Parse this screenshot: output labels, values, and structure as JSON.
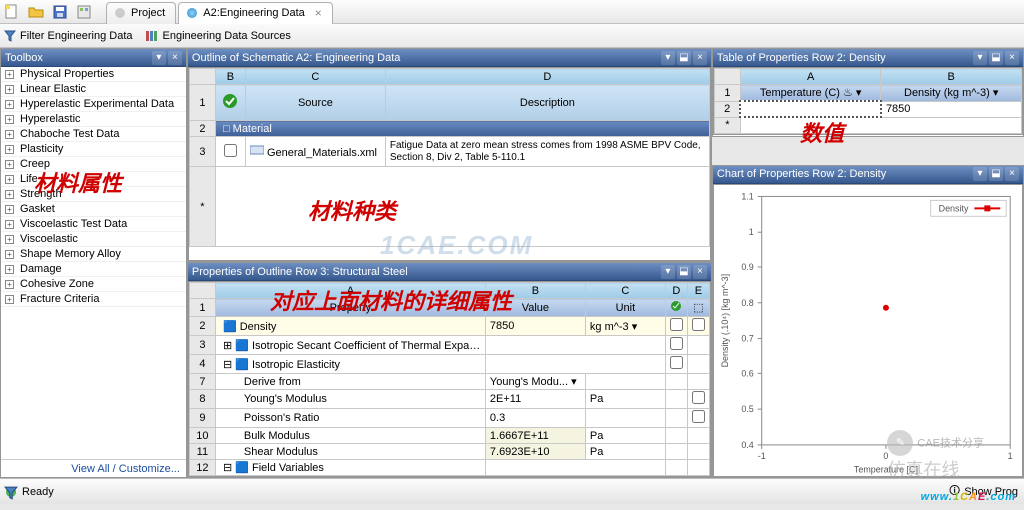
{
  "tabs": {
    "project": "Project",
    "active": "A2:Engineering Data",
    "close": "×"
  },
  "filterbar": {
    "filter": "Filter Engineering Data",
    "sources": "Engineering Data Sources"
  },
  "toolbox": {
    "title": "Toolbox",
    "items": [
      "Physical Properties",
      "Linear Elastic",
      "Hyperelastic Experimental Data",
      "Hyperelastic",
      "Chaboche Test Data",
      "Plasticity",
      "Creep",
      "Life",
      "Strength",
      "Gasket",
      "Viscoelastic Test Data",
      "Viscoelastic",
      "Shape Memory Alloy",
      "Damage",
      "Cohesive Zone",
      "Fracture Criteria"
    ],
    "footer": "View All / Customize..."
  },
  "outline": {
    "title": "Outline of Schematic A2: Engineering Data",
    "colB": "B",
    "colC": "C",
    "colD": "D",
    "r2_rh": "1",
    "r2_C": "Source",
    "r2_D": "Description",
    "mat_hdr_rh": "2",
    "mat_hdr": "Material",
    "r3_rh": "3",
    "r3_file": "General_Materials.xml",
    "r3_desc": "Fatigue Data at zero mean stress comes from 1998 ASME BPV Code, Section 8, Div 2, Table 5-110.1",
    "rstar": "*"
  },
  "props": {
    "title": "Properties of Outline Row 3: Structural Steel",
    "colA": "A",
    "colB": "B",
    "colC": "C",
    "colD": "D",
    "colE": "E",
    "h_prop": "Property",
    "h_val": "Value",
    "h_unit": "Unit",
    "rows": [
      {
        "rh": "2",
        "prop": "Density",
        "val": "7850",
        "unit": "kg m^-3"
      },
      {
        "rh": "3",
        "prop": "Isotropic Secant Coefficient of Thermal Expansion",
        "val": "",
        "unit": ""
      },
      {
        "rh": "4",
        "prop": "Isotropic Elasticity",
        "val": "",
        "unit": ""
      },
      {
        "rh": "7",
        "prop": "Derive from",
        "val": "Young's Modu...",
        "unit": ""
      },
      {
        "rh": "8",
        "prop": "Young's Modulus",
        "val": "2E+11",
        "unit": "Pa"
      },
      {
        "rh": "9",
        "prop": "Poisson's Ratio",
        "val": "0.3",
        "unit": ""
      },
      {
        "rh": "10",
        "prop": "Bulk Modulus",
        "val": "1.6667E+11",
        "unit": "Pa"
      },
      {
        "rh": "11",
        "prop": "Shear Modulus",
        "val": "7.6923E+10",
        "unit": "Pa"
      },
      {
        "rh": "12",
        "prop": "Field Variables",
        "val": "",
        "unit": ""
      }
    ]
  },
  "tprops": {
    "title": "Table of Properties Row 2: Density",
    "colA": "A",
    "colB": "B",
    "h1_rh": "1",
    "h1_A": "Temperature (C)",
    "h1_B": "Density (kg m^-3)",
    "r2_rh": "2",
    "r2_B": "7850",
    "rstar": "*"
  },
  "chart": {
    "title": "Chart of Properties Row 2: Density",
    "legend": "Density",
    "xlabel": "Temperature [C]",
    "ylabel": "Density (.10⁴) [kg m^-3]"
  },
  "chart_data": {
    "type": "scatter",
    "title": "Chart of Properties Row 2: Density",
    "xlabel": "Temperature [C]",
    "ylabel": "Density (.10^4) [kg m^-3]",
    "x": [
      0
    ],
    "y": [
      0.785
    ],
    "xlim": [
      -1,
      1
    ],
    "ylim": [
      0.4,
      1.1
    ],
    "yticks": [
      0.4,
      0.5,
      0.6,
      0.7,
      0.8,
      0.9,
      1,
      1.1
    ],
    "xticks": [
      -1,
      0,
      1
    ],
    "legend": "Density"
  },
  "status": {
    "ready": "Ready",
    "show": "Show Prog"
  },
  "annotations": {
    "a1": "材料属性",
    "a2": "材料种类",
    "a3": "对应上面材料的详细属性",
    "a4": "数值"
  },
  "watermark": {
    "w1": "1CAE.COM",
    "w2": "CAE技术分享",
    "w3": "仿真在线"
  },
  "url": "www.1CAE.com"
}
